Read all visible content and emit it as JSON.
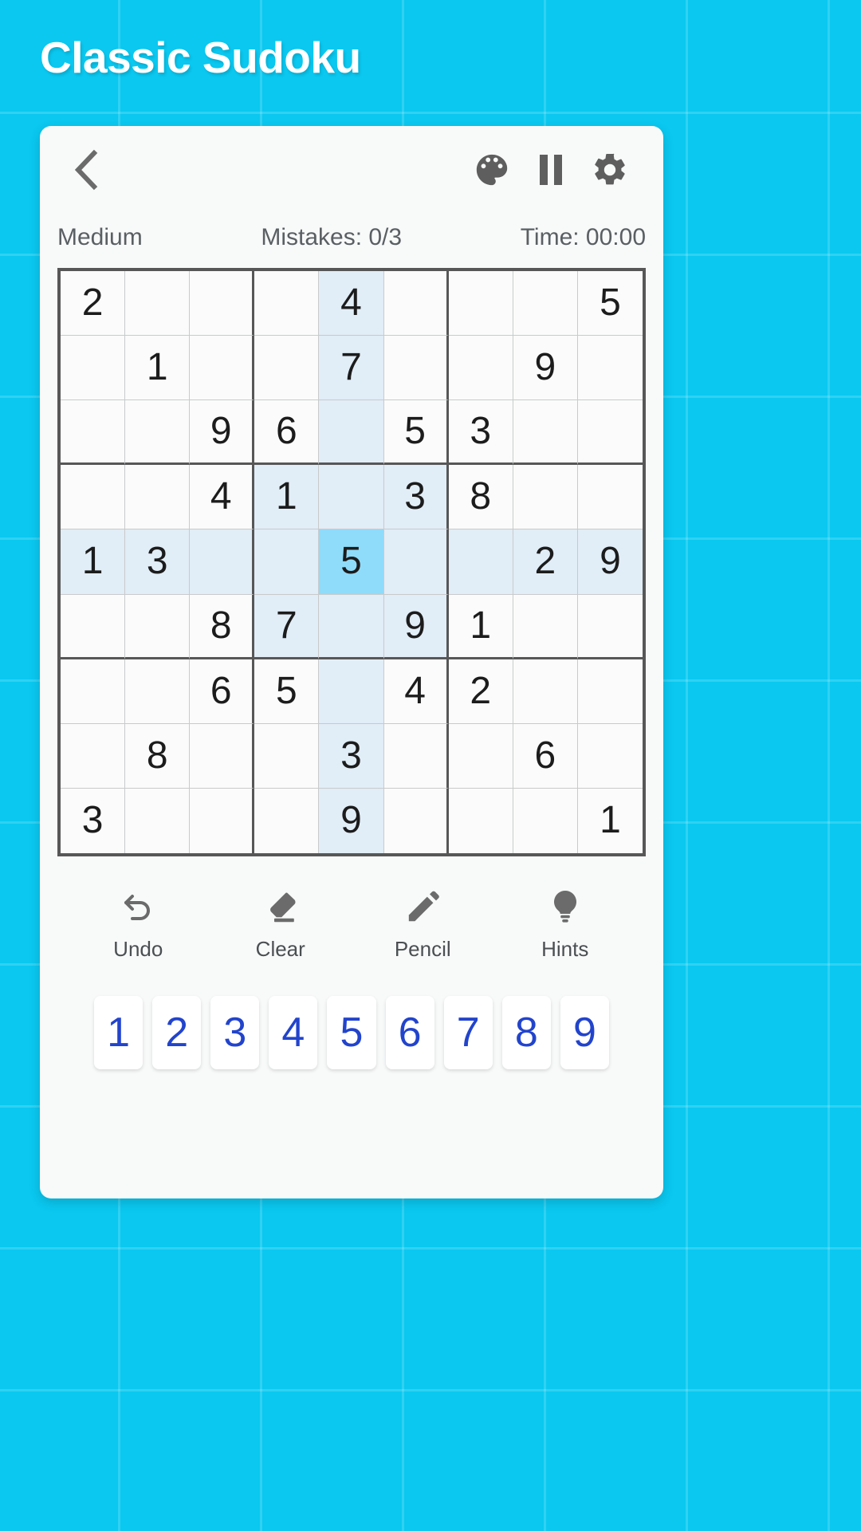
{
  "app": {
    "title": "Classic Sudoku",
    "background_color": "#0ac8f0",
    "card_color": "#f8f9f9"
  },
  "toolbar": {
    "back_icon": "chevron-left-icon",
    "theme_icon": "palette-icon",
    "pause_icon": "pause-icon",
    "settings_icon": "gear-icon"
  },
  "status": {
    "difficulty": "Medium",
    "mistakes": "Mistakes: 0/3",
    "time": "Time: 00:00"
  },
  "board": {
    "selected_cell": {
      "row": 4,
      "col": 4
    },
    "selected_color": "#8fdcfa",
    "highlight_color": "#e1edf7",
    "rows": [
      [
        "2",
        "",
        "",
        "",
        "4",
        "",
        "",
        "",
        "5"
      ],
      [
        "",
        "1",
        "",
        "",
        "7",
        "",
        "",
        "9",
        ""
      ],
      [
        "",
        "",
        "9",
        "6",
        "",
        "5",
        "3",
        "",
        ""
      ],
      [
        "",
        "",
        "4",
        "1",
        "",
        "3",
        "8",
        "",
        ""
      ],
      [
        "1",
        "3",
        "",
        "",
        "5",
        "",
        "",
        "2",
        "9"
      ],
      [
        "",
        "",
        "8",
        "7",
        "",
        "9",
        "1",
        "",
        ""
      ],
      [
        "",
        "",
        "6",
        "5",
        "",
        "4",
        "2",
        "",
        ""
      ],
      [
        "",
        "8",
        "",
        "",
        "3",
        "",
        "",
        "6",
        ""
      ],
      [
        "3",
        "",
        "",
        "",
        "9",
        "",
        "",
        "",
        "1"
      ]
    ]
  },
  "actions": [
    {
      "label": "Undo",
      "icon": "undo-icon"
    },
    {
      "label": "Clear",
      "icon": "eraser-icon"
    },
    {
      "label": "Pencil",
      "icon": "pencil-icon"
    },
    {
      "label": "Hints",
      "icon": "lightbulb-icon"
    }
  ],
  "numpad": {
    "keys": [
      "1",
      "2",
      "3",
      "4",
      "5",
      "6",
      "7",
      "8",
      "9"
    ],
    "key_color": "#2244cc"
  }
}
